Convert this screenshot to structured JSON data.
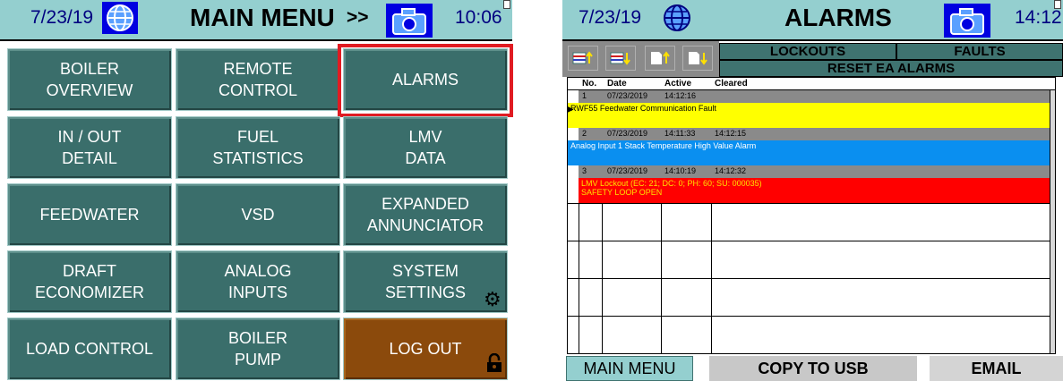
{
  "main_menu": {
    "header": {
      "date": "7/23/19",
      "title": "MAIN MENU",
      "arrows": ">>",
      "time": "10:06"
    },
    "buttons": [
      {
        "line1": "BOILER",
        "line2": "OVERVIEW"
      },
      {
        "line1": "REMOTE",
        "line2": "CONTROL"
      },
      {
        "line1": "ALARMS",
        "line2": ""
      },
      {
        "line1": "IN / OUT",
        "line2": "DETAIL"
      },
      {
        "line1": "FUEL",
        "line2": "STATISTICS"
      },
      {
        "line1": "LMV",
        "line2": "DATA"
      },
      {
        "line1": "FEEDWATER",
        "line2": ""
      },
      {
        "line1": "VSD",
        "line2": ""
      },
      {
        "line1": "EXPANDED",
        "line2": "ANNUNCIATOR"
      },
      {
        "line1": "DRAFT",
        "line2": "ECONOMIZER"
      },
      {
        "line1": "ANALOG",
        "line2": "INPUTS"
      },
      {
        "line1": "SYSTEM",
        "line2": "SETTINGS"
      },
      {
        "line1": "LOAD CONTROL",
        "line2": ""
      },
      {
        "line1": "BOILER",
        "line2": "PUMP"
      },
      {
        "line1": "LOG OUT",
        "line2": ""
      }
    ]
  },
  "alarms": {
    "header": {
      "date": "7/23/19",
      "title": "ALARMS",
      "time": "14:12"
    },
    "tabs": {
      "lockouts": "LOCKOUTS",
      "faults": "FAULTS",
      "reset": "RESET EA ALARMS"
    },
    "columns": {
      "no": "No.",
      "date": "Date",
      "active": "Active",
      "cleared": "Cleared"
    },
    "rows": [
      {
        "no": "1",
        "date": "07/23/2019",
        "active": "14:12:16",
        "cleared": "",
        "desc1": "RWF55 Feedwater Communication Fault",
        "desc2": "",
        "color": "#ffff00"
      },
      {
        "no": "2",
        "date": "07/23/2019",
        "active": "14:11:33",
        "cleared": "14:12:15",
        "desc1": "Analog Input 1 Stack Temperature High Value Alarm",
        "desc2": "",
        "color": "#0a8ff0"
      },
      {
        "no": "3",
        "date": "07/23/2019",
        "active": "14:10:19",
        "cleared": "14:12:32",
        "desc1": "LMV Lockout (EC: 21; DC: 0; PH: 60; SU: 000035)",
        "desc2": "SAFETY LOOP OPEN",
        "color": "#ff0000"
      }
    ],
    "bottom": {
      "main_menu": "MAIN MENU",
      "copy": "COPY TO USB",
      "email": "EMAIL"
    }
  }
}
